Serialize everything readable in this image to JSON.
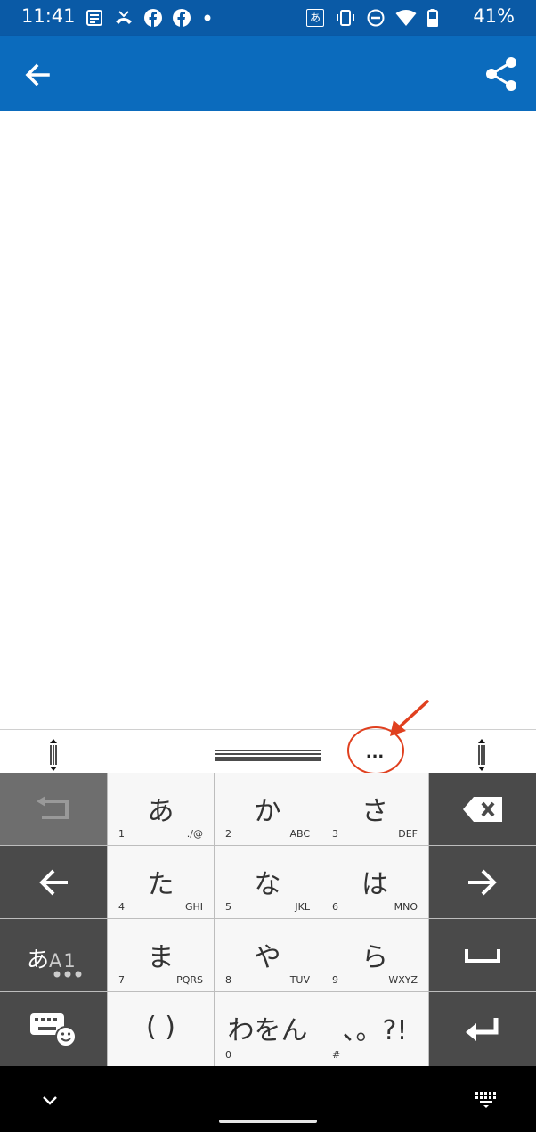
{
  "status_bar": {
    "time": "11:41",
    "battery": "41%",
    "left_icons": [
      "news-icon",
      "missed-call-icon",
      "facebook-icon",
      "facebook-icon",
      "dot-icon"
    ],
    "right_icons": [
      "ime-japanese-icon",
      "vibrate-icon",
      "do-not-disturb-icon",
      "wifi-icon",
      "battery-icon"
    ],
    "ime_glyph": "あ"
  },
  "app_bar": {
    "back_icon": "arrow-left-icon",
    "share_icon": "share-icon",
    "background": "#0b6bbd"
  },
  "keyboard_toolbar": {
    "more_label": "...",
    "left_handle_icon": "resize-handle-icon",
    "right_handle_icon": "resize-handle-icon",
    "drag_icon": "drag-bar-icon",
    "annotation_color": "#e0401f"
  },
  "keyboard": {
    "undo_icon": "undo-icon",
    "backspace_icon": "backspace-icon",
    "left_icon": "arrow-left-icon",
    "right_icon": "arrow-right-icon",
    "space_icon": "space-icon",
    "enter_icon": "enter-icon",
    "emoji_keyboard_icon": "keyboard-emoji-icon",
    "mode_key": {
      "kana": "あ",
      "alnum": "A1"
    },
    "keys": [
      {
        "main": "あ",
        "sub_left": "1",
        "sub_right": "./@"
      },
      {
        "main": "か",
        "sub_left": "2",
        "sub_right": "ABC"
      },
      {
        "main": "さ",
        "sub_left": "3",
        "sub_right": "DEF"
      },
      {
        "main": "た",
        "sub_left": "4",
        "sub_right": "GHI"
      },
      {
        "main": "な",
        "sub_left": "5",
        "sub_right": "JKL"
      },
      {
        "main": "は",
        "sub_left": "6",
        "sub_right": "MNO"
      },
      {
        "main": "ま",
        "sub_left": "7",
        "sub_right": "PQRS"
      },
      {
        "main": "や",
        "sub_left": "8",
        "sub_right": "TUV"
      },
      {
        "main": "ら",
        "sub_left": "9",
        "sub_right": "WXYZ"
      },
      {
        "main": "( )",
        "sub_left": "",
        "sub_right": ""
      },
      {
        "main": "わをん",
        "sub_left": "0",
        "sub_right": ""
      },
      {
        "main": "、。?!",
        "sub_left": "#",
        "sub_right": ""
      }
    ]
  },
  "nav_bar": {
    "down_icon": "chevron-down-icon",
    "keyboard_icon": "keyboard-icon"
  }
}
